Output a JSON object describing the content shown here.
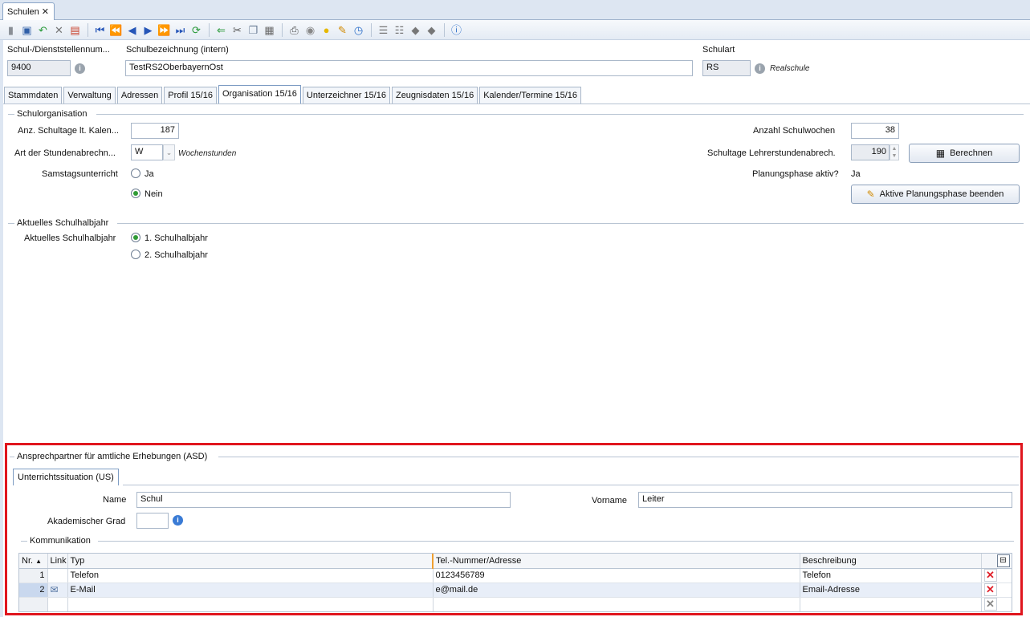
{
  "window": {
    "tab_label": "Schulen"
  },
  "toolbar": {
    "icons": [
      "new-icon",
      "save-icon",
      "undo-icon",
      "delete-icon",
      "clear-icon",
      "first-icon",
      "prev-page-icon",
      "prev-icon",
      "next-icon",
      "next-page-icon",
      "last-icon",
      "refresh-icon",
      "back-icon",
      "cut-icon",
      "copy-icon",
      "paste-icon",
      "print-icon",
      "preview-icon",
      "idea-icon",
      "broom-icon",
      "clock-icon",
      "list-icon",
      "list2-icon",
      "paint-icon",
      "paint2-icon",
      "help-icon"
    ]
  },
  "header": {
    "schulnummer_label": "Schul-/Dienststellennum...",
    "schulnummer_value": "9400",
    "bezeichnung_label": "Schulbezeichnung (intern)",
    "bezeichnung_value": "TestRS2OberbayernOst",
    "schulart_label": "Schulart",
    "schulart_value": "RS",
    "schulart_desc": "Realschule"
  },
  "tabs": [
    "Stammdaten",
    "Verwaltung",
    "Adressen",
    "Profil 15/16",
    "Organisation 15/16",
    "Unterzeichner 15/16",
    "Zeugnisdaten 15/16",
    "Kalender/Termine 15/16"
  ],
  "org": {
    "group_title": "Schulorganisation",
    "schultage_label": "Anz. Schultage lt. Kalen...",
    "schultage_value": "187",
    "stunden_label": "Art der Stundenabrechn...",
    "stunden_value": "W",
    "stunden_desc": "Wochenstunden",
    "samstag_label": "Samstagsunterricht",
    "samstag_ja": "Ja",
    "samstag_nein": "Nein",
    "schulwochen_label": "Anzahl  Schulwochen",
    "schulwochen_value": "38",
    "lehrer_label": "Schultage Lehrerstundenabrech.",
    "lehrer_value": "190",
    "berechnen_label": "Berechnen",
    "planung_label": "Planungsphase aktiv?",
    "planung_value": "Ja",
    "planung_button": "Aktive Planungsphase beenden"
  },
  "halbjahr": {
    "group_title": "Aktuelles Schulhalbjahr",
    "label": "Aktuelles Schulhalbjahr",
    "opt1": "1. Schulhalbjahr",
    "opt2": "2. Schulhalbjahr"
  },
  "asd": {
    "group_title": "Ansprechpartner für amtliche Erhebungen (ASD)",
    "tab": "Unterrichtssituation (US)",
    "name_label": "Name",
    "name_value": "Schul",
    "vorname_label": "Vorname",
    "vorname_value": "Leiter",
    "grad_label": "Akademischer Grad",
    "grad_value": "",
    "komm_title": "Kommunikation",
    "columns": [
      "Nr.",
      "Link",
      "Typ",
      "Tel.-Nummer/Adresse",
      "Beschreibung"
    ],
    "rows": [
      {
        "nr": "1",
        "typ": "Telefon",
        "adresse": "0123456789",
        "beschreibung": "Telefon"
      },
      {
        "nr": "2",
        "typ": "E-Mail",
        "adresse": "e@mail.de",
        "beschreibung": "Email-Adresse"
      }
    ]
  },
  "colors": {
    "accent_red": "#e0161e",
    "radio_green": "#2f9b35"
  }
}
